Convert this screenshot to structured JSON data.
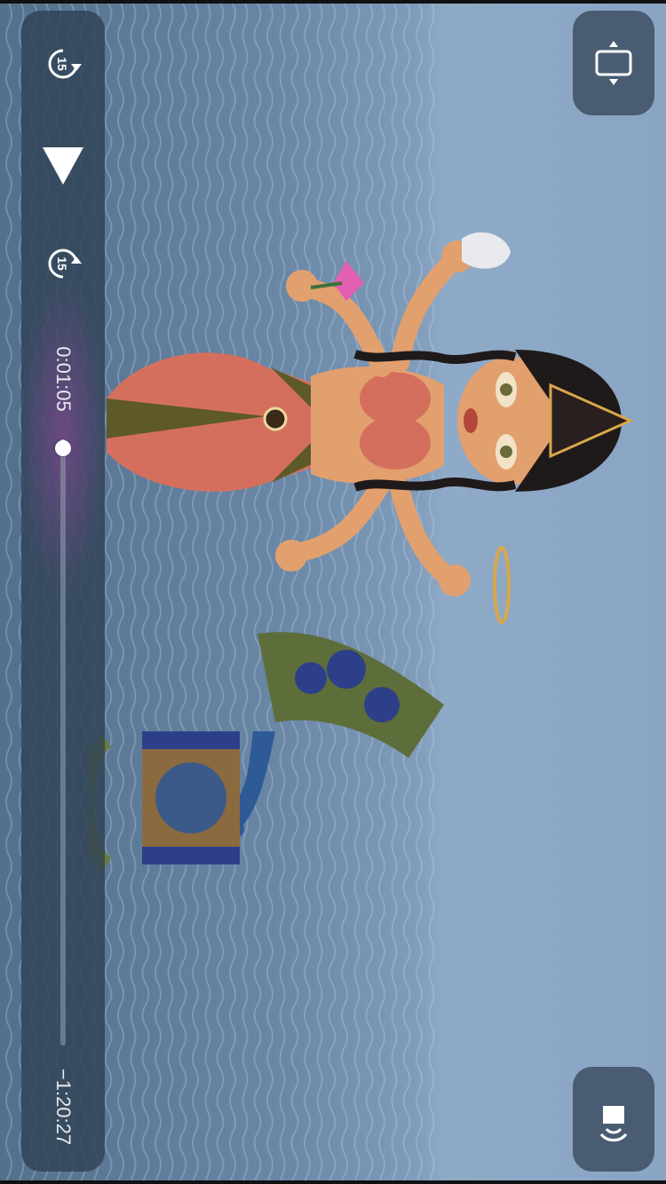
{
  "player": {
    "elapsed_time": "0:01:05",
    "remaining_time": "−1:20:27",
    "progress_fraction": 0.013,
    "skip_back_seconds": "15",
    "skip_forward_seconds": "15",
    "playback_state": "paused"
  },
  "icons": {
    "skip_back": "skip-back-15-icon",
    "play": "play-icon",
    "skip_forward": "skip-forward-15-icon",
    "aspect_toggle": "aspect-ratio-icon",
    "audio_output": "audio-output-icon"
  },
  "colors": {
    "panel": "#304256",
    "text": "#e8e8ee",
    "sky": "#8aa5c4",
    "water": "#5d7b98"
  }
}
